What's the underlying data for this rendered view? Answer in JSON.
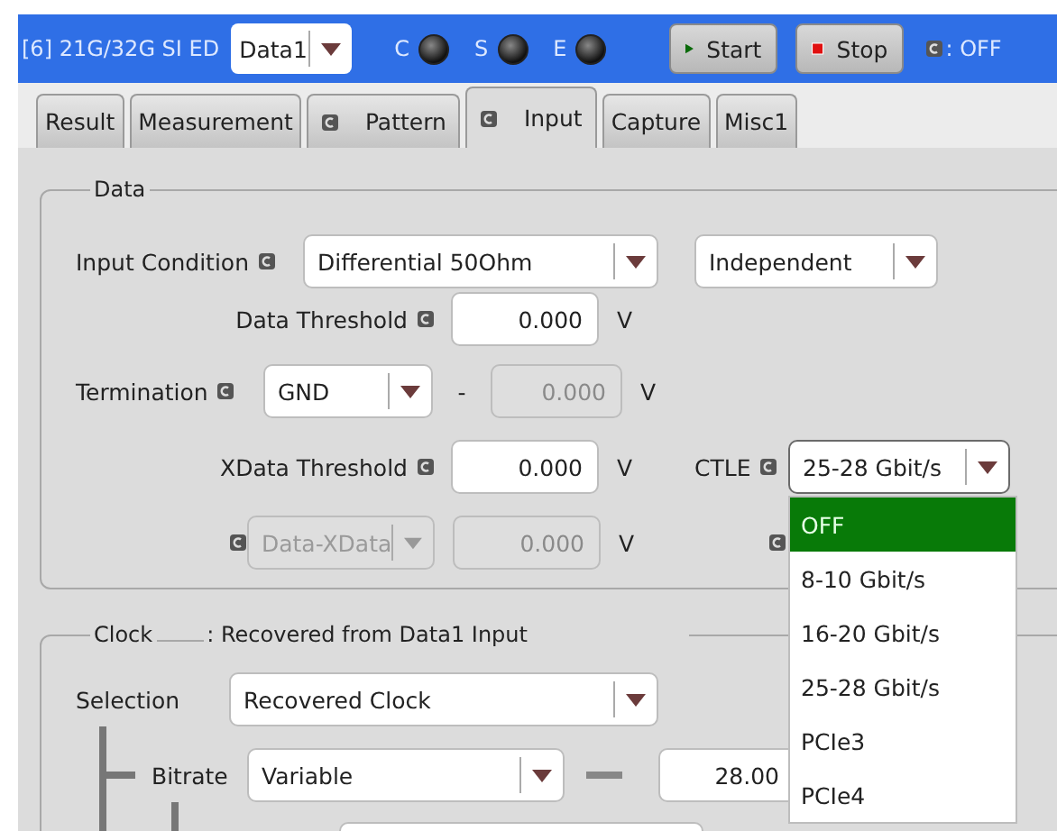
{
  "header": {
    "title": "[6] 21G/32G SI ED",
    "channel": "Data1",
    "indicators": [
      {
        "label": "C",
        "on": false
      },
      {
        "label": "S",
        "on": false
      },
      {
        "label": "E",
        "on": false
      }
    ],
    "buttons": [
      {
        "kind": "start",
        "label": "Start"
      },
      {
        "kind": "stop",
        "label": "Stop"
      }
    ],
    "status": ": OFF"
  },
  "tabs": [
    {
      "label": "Result",
      "icon": false,
      "selected": false
    },
    {
      "label": "Measurement",
      "icon": false,
      "selected": false
    },
    {
      "label": "Pattern",
      "icon": true,
      "selected": false
    },
    {
      "label": "Input",
      "icon": true,
      "selected": true
    },
    {
      "label": "Capture",
      "icon": false,
      "selected": false
    },
    {
      "label": "Misc1",
      "icon": false,
      "selected": false
    }
  ],
  "data": {
    "legend": "Data",
    "input_condition": {
      "label": "Input Condition",
      "value": "Differential 50Ohm",
      "mode": "Independent"
    },
    "data_threshold": {
      "label": "Data Threshold",
      "value": "0.000",
      "unit": "V"
    },
    "termination": {
      "label": "Termination",
      "value": "GND",
      "separator": "-",
      "voltage": "0.000",
      "voltage_disabled": true,
      "unit": "V"
    },
    "xdata_threshold": {
      "label": "XData Threshold",
      "value": "0.000",
      "unit": "V"
    },
    "ctle": {
      "label": "CTLE",
      "value": "25-28 Gbit/s",
      "expanded": true,
      "options": [
        {
          "label": "OFF",
          "highlighted": true
        },
        {
          "label": "8-10 Gbit/s",
          "highlighted": false
        },
        {
          "label": "16-20 Gbit/s",
          "highlighted": false
        },
        {
          "label": "25-28 Gbit/s",
          "highlighted": false
        },
        {
          "label": "PCIe3",
          "highlighted": false
        },
        {
          "label": "PCIe4",
          "highlighted": false
        }
      ]
    },
    "compare": {
      "mode": "Data-XData",
      "mode_disabled": true,
      "value": "0.000",
      "value_disabled": true,
      "unit": "V"
    }
  },
  "clock": {
    "legend": "Clock",
    "source": ": Recovered from Data1 Input",
    "selection": {
      "label": "Selection",
      "value": "Recovered Clock"
    },
    "bitrate": {
      "label": "Bitrate",
      "value": "Variable",
      "rate": "28.00"
    }
  }
}
